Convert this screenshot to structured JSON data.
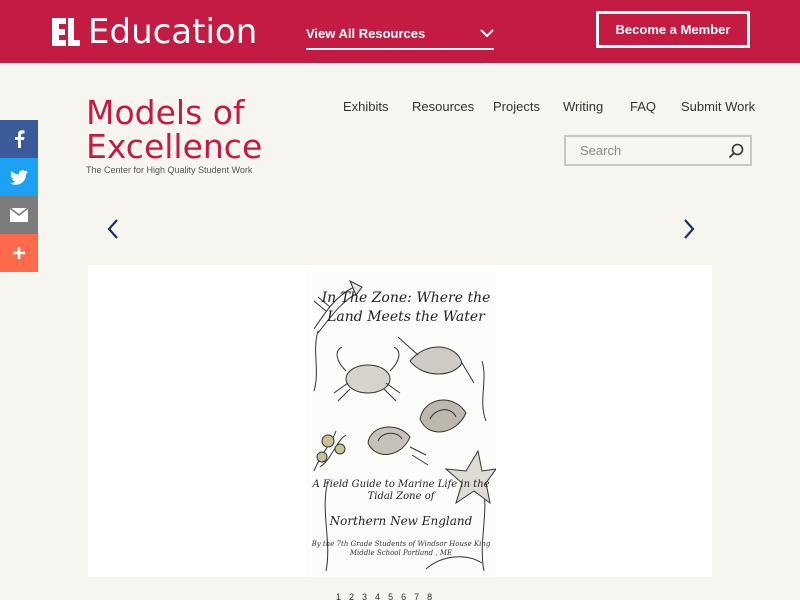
{
  "brand": {
    "name": "Education",
    "mark_icon": "el-logo-icon"
  },
  "topbar": {
    "view_all_label": "View All Resources",
    "member_button": "Become a Member",
    "color": "#c41b43"
  },
  "logo": {
    "line1": "Models of",
    "line2": "Excellence",
    "tagline": "The Center for High Quality Student Work"
  },
  "nav": {
    "items": [
      "Exhibits",
      "Resources",
      "Projects",
      "Writing",
      "FAQ",
      "Submit Work"
    ]
  },
  "search": {
    "placeholder": "Search",
    "icon": "search-icon"
  },
  "social": {
    "icons": [
      "facebook-icon",
      "twitter-icon",
      "email-icon",
      "share-plus-icon"
    ],
    "colors": {
      "facebook": "#3b5a9a",
      "twitter": "#1da1f2",
      "email": "#7c7c7c",
      "more": "#ff6a4d"
    }
  },
  "carousel": {
    "slide": {
      "title": "In The Zone: Where the Land Meets the Water",
      "subtitle": "A Field Guide to Marine Life in the Tidal Zone of",
      "region": "Northern New England",
      "credit": "By the 7th Grade Students of Windsor House King Middle School Portland , ME"
    },
    "pages": [
      "1",
      "2",
      "3",
      "4",
      "5",
      "6",
      "7",
      "8"
    ]
  }
}
